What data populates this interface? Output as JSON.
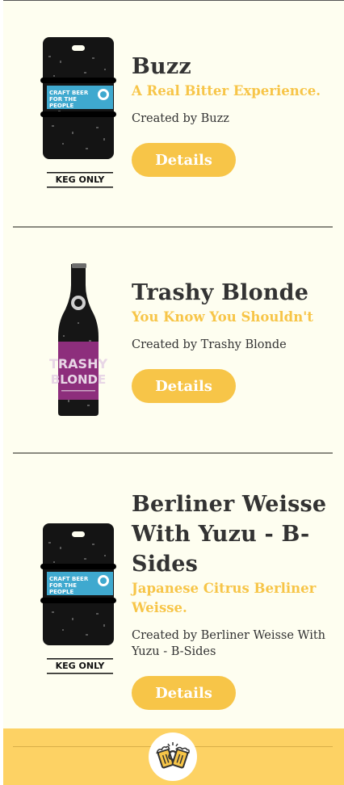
{
  "beers": [
    {
      "name": "Buzz",
      "tagline": "A Real Bitter Experience.",
      "creator": "Created by Buzz",
      "details_label": "Details",
      "image_type": "keg-icon",
      "keg_label": "KEG ONLY",
      "keg_text": "CRAFT BEER FOR THE PEOPLE"
    },
    {
      "name": "Trashy Blonde",
      "tagline": "You Know You Shouldn't",
      "creator": "Created by Trashy Blonde",
      "details_label": "Details",
      "image_type": "bottle-icon",
      "bottle_text": "TRASHY BLONDE"
    },
    {
      "name": "Berliner Weisse With Yuzu - B-Sides",
      "tagline": "Japanese Citrus Berliner Weisse.",
      "creator": "Created by Berliner Weisse With Yuzu - B-Sides",
      "details_label": "Details",
      "image_type": "keg-icon",
      "keg_label": "KEG ONLY",
      "keg_text": "CRAFT BEER FOR THE PEOPLE"
    }
  ],
  "footer": {
    "logo_icon": "beer-mugs-icon"
  },
  "colors": {
    "accent": "#f7c548",
    "background": "#fefef0",
    "text": "#333333",
    "footer": "#fdd264"
  }
}
